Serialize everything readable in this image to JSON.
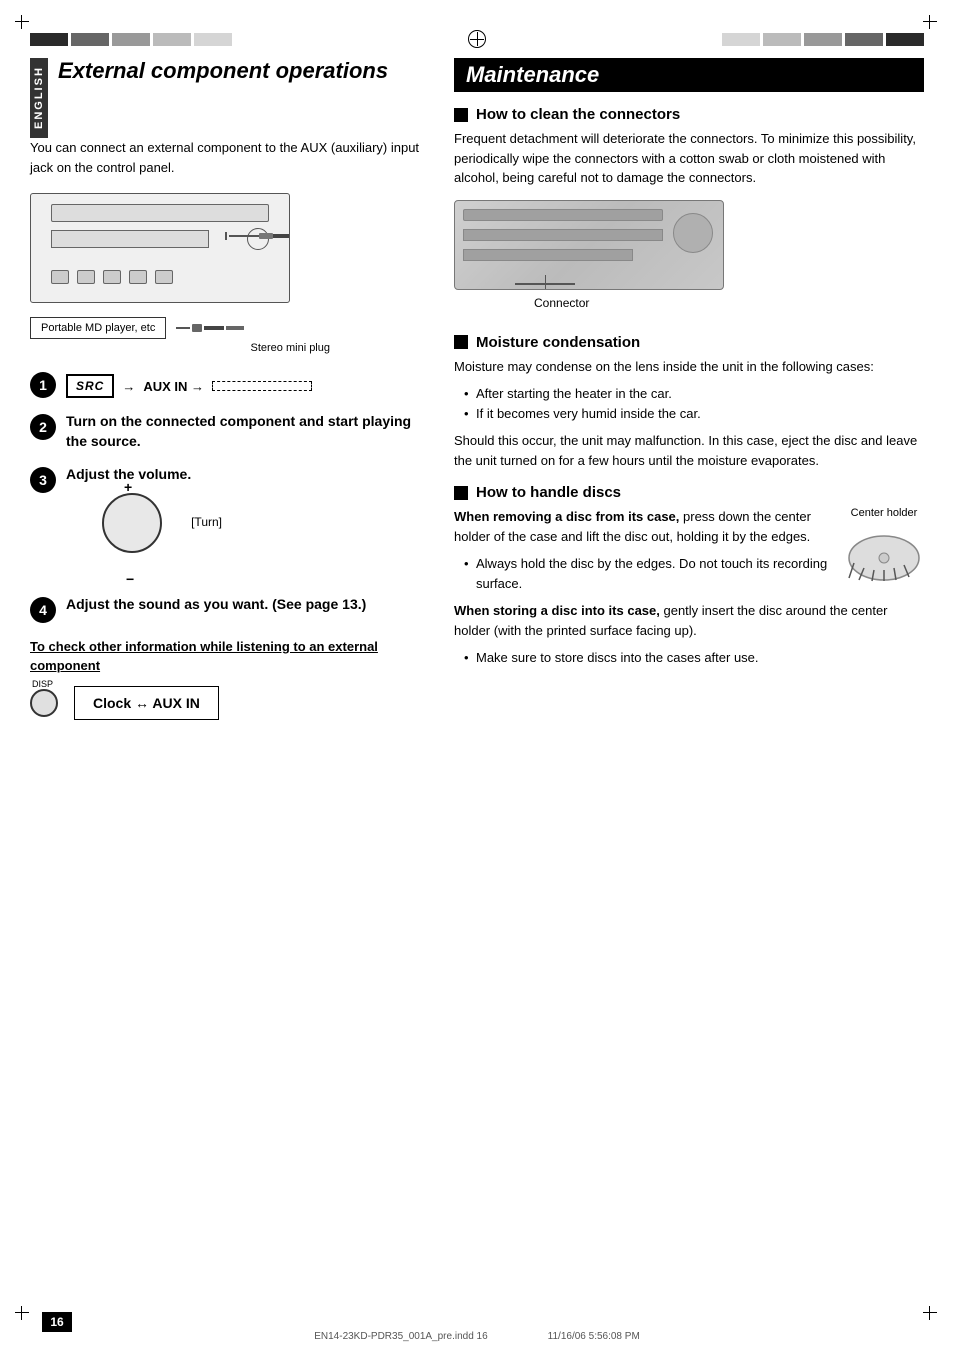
{
  "page": {
    "number": "16",
    "file_info_left": "EN14-23KD-PDR35_001A_pre.indd   16",
    "file_info_right": "11/16/06   5:56:08 PM"
  },
  "left_section": {
    "sidebar_label": "ENGLISH",
    "title": "External component operations",
    "intro_text": "You can connect an external component to the AUX (auxiliary) input jack on the control panel.",
    "device_labels": {
      "portable": "Portable MD player, etc",
      "stereo_mini_plug": "Stereo mini plug"
    },
    "steps": [
      {
        "number": "1",
        "src_button": "SRC",
        "aux_in_label": "AUX IN →"
      },
      {
        "number": "2",
        "text": "Turn on the connected component and start playing the source."
      },
      {
        "number": "3",
        "text": "Adjust the volume.",
        "turn_label": "[Turn]",
        "plus": "+",
        "minus": "−"
      },
      {
        "number": "4",
        "text": "Adjust the sound as you want. (See page 13.)"
      }
    ],
    "check_heading": "To check other information while listening to an external component",
    "disp_label": "DISP",
    "clock_aux_text": "Clock ↔ AUX IN"
  },
  "right_section": {
    "title": "Maintenance",
    "subsections": [
      {
        "id": "clean-connectors",
        "title": "How to clean the connectors",
        "text": "Frequent detachment will deteriorate the connectors. To minimize this possibility, periodically wipe the connectors with a cotton swab or cloth moistened with alcohol, being careful not to damage the connectors.",
        "connector_label": "Connector"
      },
      {
        "id": "moisture",
        "title": "Moisture condensation",
        "intro": "Moisture may condense on the lens inside the unit in the following cases:",
        "bullets": [
          "After starting the heater in the car.",
          "If it becomes very humid inside the car."
        ],
        "after_text": "Should this occur, the unit may malfunction. In this case, eject the disc and leave the unit turned on for a few hours until the moisture evaporates."
      },
      {
        "id": "handle-discs",
        "title": "How to handle discs",
        "center_holder_label": "Center holder",
        "bold_intro": "When removing a disc from its case,",
        "removing_text": " press down the center holder of the case and lift the disc out, holding it by the edges.",
        "bullet2": "Always hold the disc by the edges. Do not touch its recording surface.",
        "bold_storing": "When storing a disc into its case,",
        "storing_text": " gently insert the disc around the center holder (with the printed surface facing up).",
        "bullet3": "Make sure to store discs into the cases after use."
      }
    ]
  }
}
